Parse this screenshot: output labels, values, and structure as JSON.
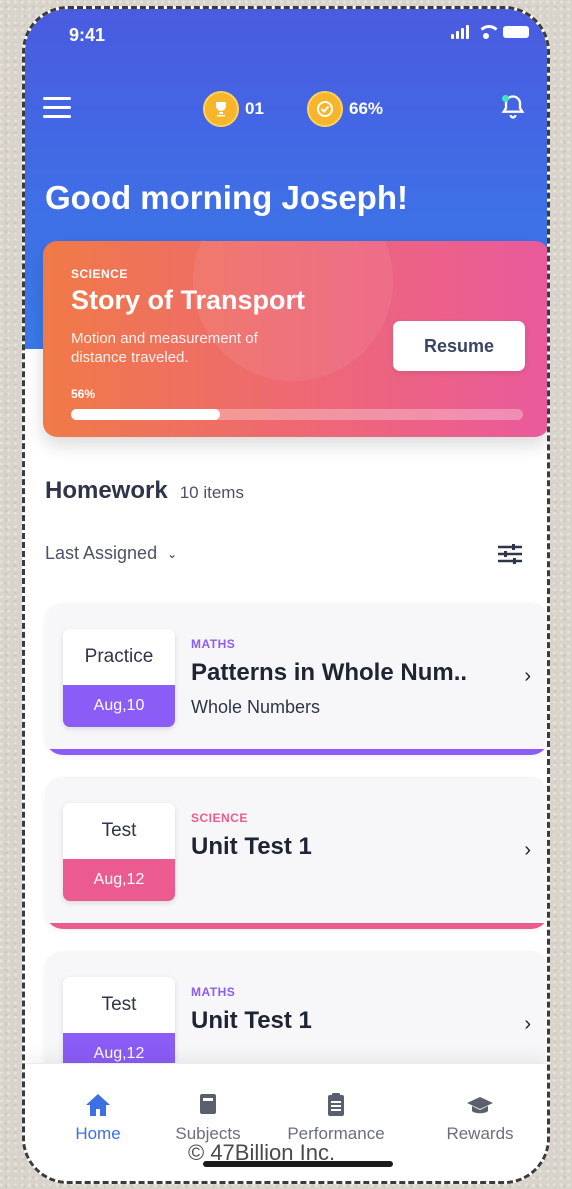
{
  "status": {
    "time": "9:41"
  },
  "header": {
    "trophy_count": "01",
    "progress_percent": "66%",
    "colors": {
      "hero": "#4a5be0",
      "coin": "#f7b52c"
    }
  },
  "greeting": "Good morning Joseph!",
  "current_lesson": {
    "subject": "SCIENCE",
    "title": "Story of Transport",
    "description": "Motion and measurement of distance traveled.",
    "resume_label": "Resume",
    "percent_label": "56%",
    "progress": 0.56
  },
  "homework": {
    "title": "Homework",
    "count": "10 items",
    "sort_label": "Last Assigned",
    "items": [
      {
        "type": "Practice",
        "date": "Aug,10",
        "subject": "MATHS",
        "title": "Patterns in Whole Num..",
        "topic": "Whole Numbers",
        "accent": "#8b5cf6",
        "subject_color": "#8b5cf6"
      },
      {
        "type": "Test",
        "date": "Aug,12",
        "subject": "SCIENCE",
        "title": "Unit Test 1",
        "topic": "",
        "accent": "#ec5b8f",
        "subject_color": "#ec5b8f"
      },
      {
        "type": "Test",
        "date": "Aug,12",
        "subject": "MATHS",
        "title": "Unit Test 1",
        "topic": "",
        "accent": "#8b5cf6",
        "subject_color": "#8b5cf6"
      }
    ]
  },
  "nav": {
    "home": "Home",
    "subjects": "Subjects",
    "performance": "Performance",
    "rewards": "Rewards"
  },
  "watermark": "© 47Billion Inc."
}
